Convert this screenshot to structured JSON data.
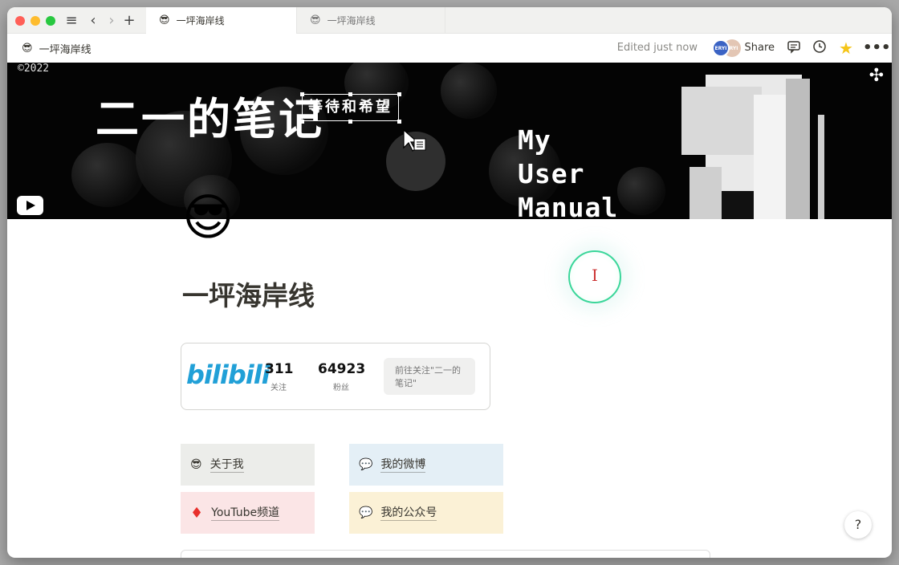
{
  "tabs": [
    {
      "emoji": "😎",
      "title": "一坪海岸线"
    },
    {
      "emoji": "😎",
      "title": "一坪海岸线"
    }
  ],
  "breadcrumb": {
    "emoji": "😎",
    "title": "一坪海岸线"
  },
  "topbar": {
    "edited": "Edited just now",
    "avatar1": "ERYI",
    "avatar2": "ERYI",
    "share": "Share"
  },
  "banner": {
    "copyright": "©2022",
    "main_title": "二一的笔记",
    "subtitle": "等待和希望",
    "manual_lines": [
      "My",
      "User",
      "Manual"
    ]
  },
  "page": {
    "emoji": "😎",
    "title": "一坪海岸线",
    "cursor_glyph": "I"
  },
  "bilibili": {
    "logo": "bilibili",
    "following_num": "311",
    "following_label": "关注",
    "fans_num": "64923",
    "fans_label": "粉丝",
    "follow_text": "前往关注\"二一的笔记\""
  },
  "links": [
    {
      "emoji": "😎",
      "label": "关于我"
    },
    {
      "emoji": "💬",
      "label": "我的微博"
    },
    {
      "emoji": "♦",
      "label": "YouTube频道"
    },
    {
      "emoji": "💬",
      "label": "我的公众号"
    }
  ],
  "help": "?",
  "colors": {
    "bilibili_blue": "#21a0d7",
    "ring_green": "#3bd69a",
    "star": "#f5c518"
  }
}
